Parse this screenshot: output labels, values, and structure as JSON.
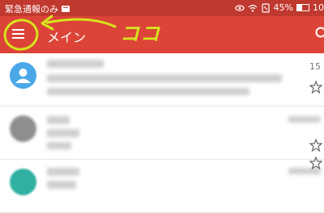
{
  "status_bar": {
    "notification_text": "緊急通報のみ",
    "battery_percent_text": "45%",
    "battery_level": 0.45,
    "clock_partial": "10"
  },
  "app_bar": {
    "menu_icon": "hamburger-menu-icon",
    "title": "メイン",
    "search_icon": "search-icon"
  },
  "annotation": {
    "text": "ココ",
    "color": "#d6e51c"
  },
  "colors": {
    "status_bar": "#c0392f",
    "app_bar": "#db4437",
    "avatar_1": "#4aa8e8",
    "avatar_2": "#8e8e8e",
    "avatar_3": "#2fb0a0"
  },
  "inbox": {
    "rows": [
      {
        "date": "15"
      },
      {
        "date": ""
      },
      {
        "date": ""
      }
    ]
  }
}
